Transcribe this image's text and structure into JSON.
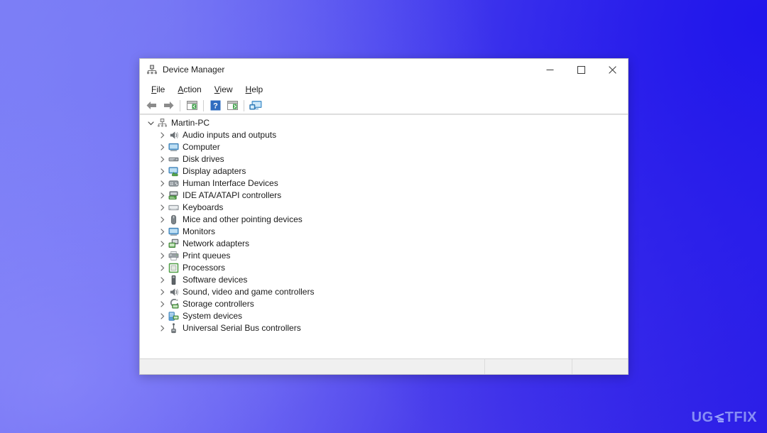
{
  "desktop": {
    "background_colors": [
      "#7a7cf2",
      "#5a52ee",
      "#2e20e6"
    ],
    "watermark": {
      "text_before": "UG",
      "text_after": "TFIX",
      "full_text": "UGETFIX",
      "color": "#9aa2fa"
    }
  },
  "window": {
    "title": "Device Manager",
    "icon": "device-manager-icon",
    "controls": {
      "minimize": "Minimize",
      "maximize": "Maximize",
      "close": "Close"
    },
    "menubar": {
      "items": [
        {
          "label": "File",
          "accel": "F",
          "rest": "ile"
        },
        {
          "label": "Action",
          "accel": "A",
          "rest": "ction"
        },
        {
          "label": "View",
          "accel": "V",
          "rest": "iew"
        },
        {
          "label": "Help",
          "accel": "H",
          "rest": "elp"
        }
      ]
    },
    "toolbar": {
      "items": [
        {
          "name": "back-button",
          "tooltip": "Back"
        },
        {
          "name": "forward-button",
          "tooltip": "Forward"
        },
        {
          "name": "separator",
          "tooltip": ""
        },
        {
          "name": "show-hide-console-tree-button",
          "tooltip": "Show/Hide Console Tree"
        },
        {
          "name": "separator",
          "tooltip": ""
        },
        {
          "name": "help-button",
          "tooltip": "Help"
        },
        {
          "name": "properties-button",
          "tooltip": "Properties"
        },
        {
          "name": "separator",
          "tooltip": ""
        },
        {
          "name": "scan-hardware-changes-button",
          "tooltip": "Scan for hardware changes"
        }
      ]
    },
    "tree": {
      "root": {
        "label": "Martin-PC",
        "icon": "computer-node-icon",
        "expanded": true,
        "chevron": "chevron-down-icon"
      },
      "children": [
        {
          "label": "Audio inputs and outputs",
          "icon": "speaker-icon",
          "chevron": "chevron-right-icon"
        },
        {
          "label": "Computer",
          "icon": "monitor-icon",
          "chevron": "chevron-right-icon"
        },
        {
          "label": "Disk drives",
          "icon": "disk-drive-icon",
          "chevron": "chevron-right-icon"
        },
        {
          "label": "Display adapters",
          "icon": "display-adapter-icon",
          "chevron": "chevron-right-icon"
        },
        {
          "label": "Human Interface Devices",
          "icon": "hid-icon",
          "chevron": "chevron-right-icon"
        },
        {
          "label": "IDE ATA/ATAPI controllers",
          "icon": "ide-controller-icon",
          "chevron": "chevron-right-icon"
        },
        {
          "label": "Keyboards",
          "icon": "keyboard-icon",
          "chevron": "chevron-right-icon"
        },
        {
          "label": "Mice and other pointing devices",
          "icon": "mouse-icon",
          "chevron": "chevron-right-icon"
        },
        {
          "label": "Monitors",
          "icon": "monitor-icon",
          "chevron": "chevron-right-icon"
        },
        {
          "label": "Network adapters",
          "icon": "network-adapter-icon",
          "chevron": "chevron-right-icon"
        },
        {
          "label": "Print queues",
          "icon": "printer-icon",
          "chevron": "chevron-right-icon"
        },
        {
          "label": "Processors",
          "icon": "processor-icon",
          "chevron": "chevron-right-icon"
        },
        {
          "label": "Software devices",
          "icon": "software-device-icon",
          "chevron": "chevron-right-icon"
        },
        {
          "label": "Sound, video and game controllers",
          "icon": "sound-controller-icon",
          "chevron": "chevron-right-icon"
        },
        {
          "label": "Storage controllers",
          "icon": "storage-controller-icon",
          "chevron": "chevron-right-icon"
        },
        {
          "label": "System devices",
          "icon": "system-device-icon",
          "chevron": "chevron-right-icon"
        },
        {
          "label": "Universal Serial Bus controllers",
          "icon": "usb-icon",
          "chevron": "chevron-right-icon"
        }
      ]
    },
    "statusbar": {
      "panes": [
        "",
        "",
        ""
      ]
    }
  }
}
